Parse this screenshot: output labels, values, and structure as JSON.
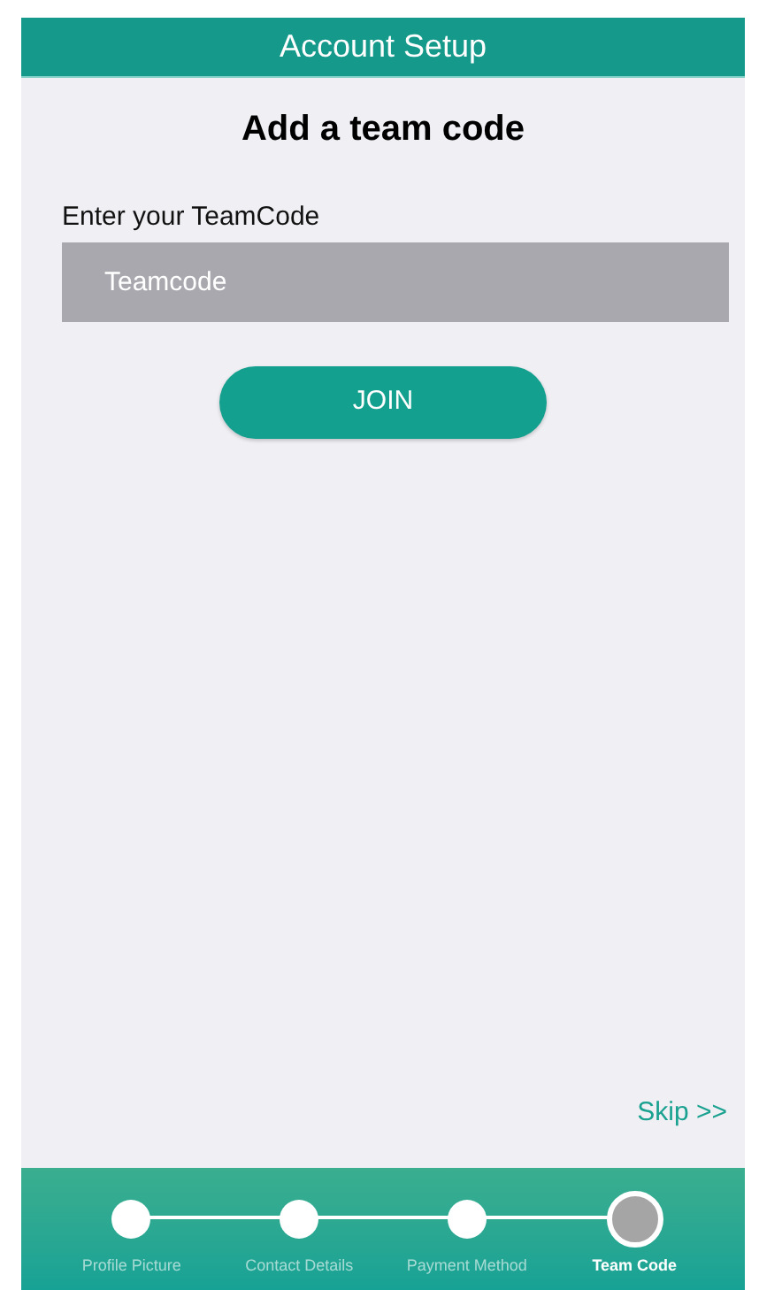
{
  "header": {
    "title": "Account Setup"
  },
  "heading": "Add a team code",
  "field": {
    "label": "Enter your TeamCode",
    "placeholder": "Teamcode"
  },
  "join_button": "JOIN",
  "skip_link": "Skip >>",
  "steps": [
    {
      "label": "Profile Picture",
      "selected": false
    },
    {
      "label": "Contact Details",
      "selected": false
    },
    {
      "label": "Payment Method",
      "selected": false
    },
    {
      "label": "Team Code",
      "selected": true
    }
  ]
}
